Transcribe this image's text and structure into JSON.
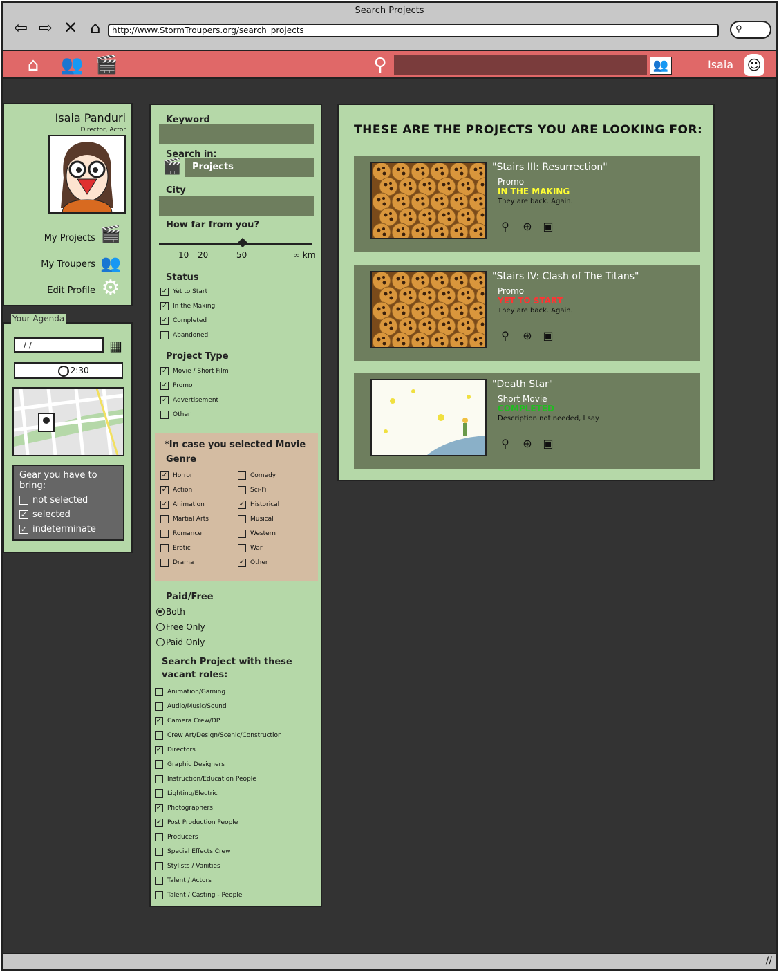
{
  "window": {
    "title": "Search Projects",
    "url": "http://www.StormTroupers.org/search_projects"
  },
  "appbar": {
    "username": "Isaia"
  },
  "profile": {
    "name": "Isaia Panduri",
    "roles": "Director, Actor",
    "menu": [
      {
        "label": "My Projects",
        "icon": "clapperboard-icon"
      },
      {
        "label": "My Troupers",
        "icon": "group-icon"
      },
      {
        "label": "Edit Profile",
        "icon": "gear-icon"
      }
    ]
  },
  "agenda": {
    "label": "Your Agenda",
    "date_value": "/ /",
    "time_value": "12:30",
    "gear": {
      "title": "Gear you have to bring:",
      "items": [
        {
          "label": "not selected",
          "checked": false
        },
        {
          "label": "selected",
          "checked": true
        },
        {
          "label": "indeterminate",
          "checked": true
        }
      ]
    }
  },
  "filters": {
    "keyword_label": "Keyword",
    "search_in_label": "Search in:",
    "search_in_value": "Projects",
    "city_label": "City",
    "distance_label": "How far from you?",
    "distance_ticks": [
      "10",
      "20",
      "50",
      "∞ km"
    ],
    "distance_value": 50,
    "status_label": "Status",
    "status": [
      {
        "label": "Yet to Start",
        "checked": true
      },
      {
        "label": "In the Making",
        "checked": true
      },
      {
        "label": "Completed",
        "checked": true
      },
      {
        "label": "Abandoned",
        "checked": false
      }
    ],
    "type_label": "Project Type",
    "types": [
      {
        "label": "Movie / Short Film",
        "checked": true
      },
      {
        "label": "Promo",
        "checked": true
      },
      {
        "label": "Advertisement",
        "checked": true
      },
      {
        "label": "Other",
        "checked": false
      }
    ],
    "genre_note": "*In case you selected Movie",
    "genre_label": "Genre",
    "genres_left": [
      {
        "label": "Horror",
        "checked": true
      },
      {
        "label": "Action",
        "checked": true
      },
      {
        "label": "Animation",
        "checked": true
      },
      {
        "label": "Martial Arts",
        "checked": false
      },
      {
        "label": "Romance",
        "checked": false
      },
      {
        "label": "Erotic",
        "checked": false
      },
      {
        "label": "Drama",
        "checked": false
      }
    ],
    "genres_right": [
      {
        "label": "Comedy",
        "checked": false
      },
      {
        "label": "Sci-Fi",
        "checked": false
      },
      {
        "label": "Historical",
        "checked": true
      },
      {
        "label": "Musical",
        "checked": false
      },
      {
        "label": "Western",
        "checked": false
      },
      {
        "label": "War",
        "checked": false
      },
      {
        "label": "Other",
        "checked": true
      }
    ],
    "paid_label": "Paid/Free",
    "paid_options": [
      {
        "label": "Both",
        "selected": true
      },
      {
        "label": "Free Only",
        "selected": false
      },
      {
        "label": "Paid Only",
        "selected": false
      }
    ],
    "roles_label": "Search Project with these vacant roles:",
    "roles": [
      {
        "label": "Animation/Gaming",
        "checked": false
      },
      {
        "label": "Audio/Music/Sound",
        "checked": false
      },
      {
        "label": "Camera Crew/DP",
        "checked": true
      },
      {
        "label": "Crew Art/Design/Scenic/Construction",
        "checked": false
      },
      {
        "label": "Directors",
        "checked": true
      },
      {
        "label": "Graphic Designers",
        "checked": false
      },
      {
        "label": "Instruction/Education People",
        "checked": false
      },
      {
        "label": "Lighting/Electric",
        "checked": false
      },
      {
        "label": "Photographers",
        "checked": true
      },
      {
        "label": "Post Production People",
        "checked": true
      },
      {
        "label": "Producers",
        "checked": false
      },
      {
        "label": "Special Effects Crew",
        "checked": false
      },
      {
        "label": "Stylists / Vanities",
        "checked": false
      },
      {
        "label": "Talent / Actors",
        "checked": false
      },
      {
        "label": "Talent / Casting - People",
        "checked": false
      }
    ]
  },
  "results": {
    "heading": "THESE ARE THE PROJECTS YOU ARE LOOKING FOR:",
    "items": [
      {
        "title": "\"Stairs III: Resurrection\"",
        "type": "Promo",
        "status": "IN THE MAKING",
        "status_color": "#ffff33",
        "description": "They are back. Again.",
        "thumb": "cookies"
      },
      {
        "title": "\"Stairs IV: Clash of The Titans\"",
        "type": "Promo",
        "status": "YET TO START",
        "status_color": "#ff3333",
        "description": "They are back. Again.",
        "thumb": "cookies"
      },
      {
        "title": "\"Death Star\"",
        "type": "Short Movie",
        "status": "COMPLETED",
        "status_color": "#22bb22",
        "description": "Description not needed, I say",
        "thumb": "little-prince"
      }
    ]
  }
}
